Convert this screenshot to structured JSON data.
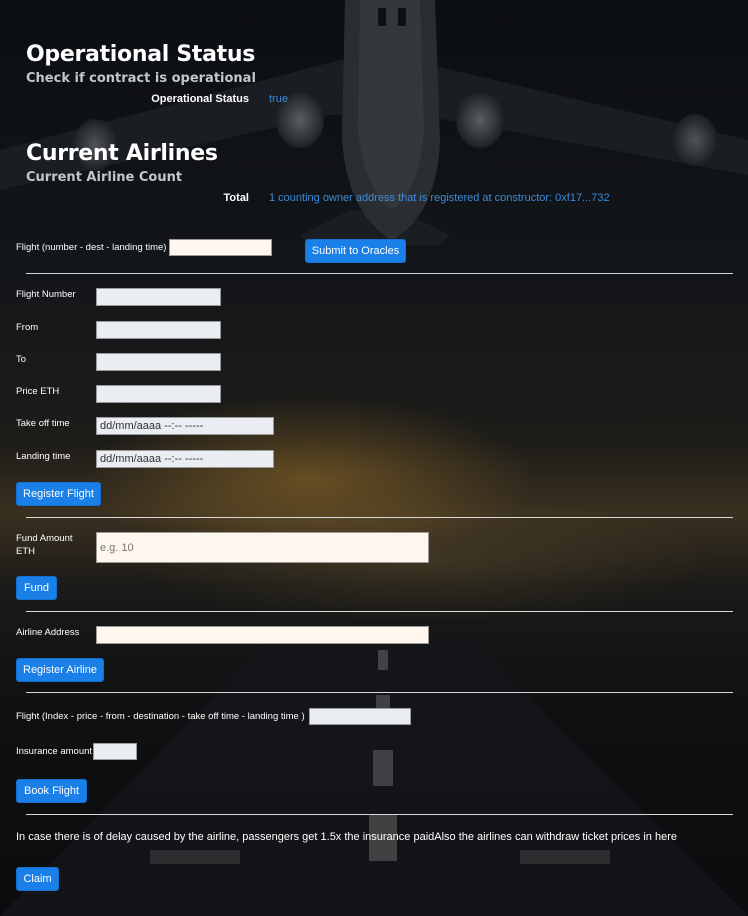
{
  "operational": {
    "title": "Operational Status",
    "subtitle": "Check if contract is operational",
    "label": "Operational Status",
    "value": "true"
  },
  "airlines": {
    "title": "Current Airlines",
    "subtitle": "Current Airline Count",
    "label": "Total",
    "value": "1 counting owner address that is registered at constructor: 0xf17...732"
  },
  "oracle": {
    "label": "Flight (number - dest - landing time)",
    "input_value": "",
    "submit_label": "Submit to Oracles"
  },
  "register_flight": {
    "flight_number_label": "Flight Number",
    "from_label": "From",
    "to_label": "To",
    "price_label": "Price ETH",
    "takeoff_label": "Take off time",
    "landing_label": "Landing time",
    "takeoff_value": "dd/mm/aaaa --:-- -----",
    "landing_value": "dd/mm/aaaa --:-- -----",
    "button_label": "Register Flight"
  },
  "fund": {
    "label": "Fund Amount ETH",
    "placeholder": "e.g. 10",
    "button_label": "Fund"
  },
  "register_airline": {
    "label": "Airline Address",
    "button_label": "Register Airline"
  },
  "book": {
    "flight_label": "Flight (Index - price - from - destination - take off time - landing time )",
    "insurance_label": "Insurance amount",
    "button_label": "Book Flight"
  },
  "claim": {
    "text": "In case there is of delay caused by the airline, passengers get 1.5x the insurance paidAlso the airlines can withdraw ticket prices in here",
    "button_label": "Claim"
  },
  "colors": {
    "accent": "#1a7fe6",
    "link": "#3d8bd8",
    "divider": "#d9d9d9"
  }
}
